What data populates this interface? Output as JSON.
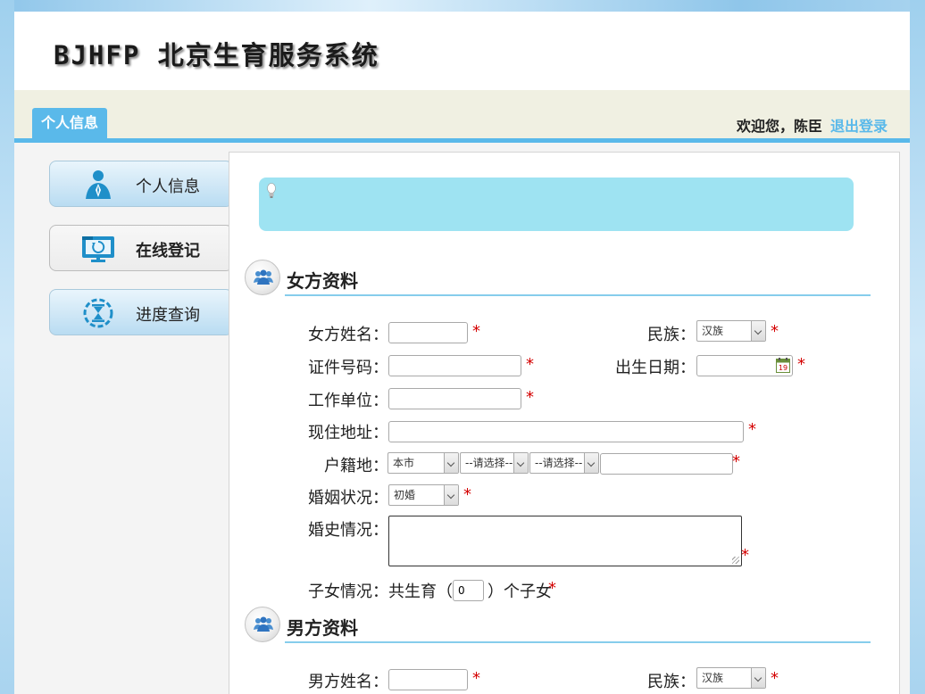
{
  "header": {
    "logo": "BJHFP 北京生育服务系统"
  },
  "nav": {
    "active_tab": "个人信息",
    "welcome": "欢迎您，陈臣",
    "logout": "退出登录"
  },
  "sidebar": {
    "items": [
      {
        "label": "个人信息",
        "icon": "person-icon",
        "active": false
      },
      {
        "label": "在线登记",
        "icon": "monitor-icon",
        "active": true
      },
      {
        "label": "进度查询",
        "icon": "hourglass-icon",
        "active": false
      }
    ]
  },
  "colors": {
    "accent": "#5ab9ea",
    "tip": "#9ee3f2",
    "required": "#d40000"
  },
  "female": {
    "title": "女方资料",
    "name_label": "女方姓名：",
    "ethnicity_label": "民族：",
    "ethnicity_value": "汉族",
    "id_label": "证件号码：",
    "birth_label": "出生日期：",
    "work_label": "工作单位：",
    "address_label": "现住地址：",
    "huji_label": "户籍地：",
    "huji_city": "本市",
    "huji_select2": "--请选择--",
    "huji_select3": "--请选择--",
    "marital_label": "婚姻状况：",
    "marital_value": "初婚",
    "history_label": "婚史情况：",
    "children_prefix": "子女情况：共生育（",
    "children_count": "0",
    "children_suffix": "）个子女"
  },
  "male": {
    "title": "男方资料",
    "name_label": "男方姓名：",
    "ethnicity_label": "民族：",
    "ethnicity_value": "汉族"
  },
  "required_mark": "*"
}
